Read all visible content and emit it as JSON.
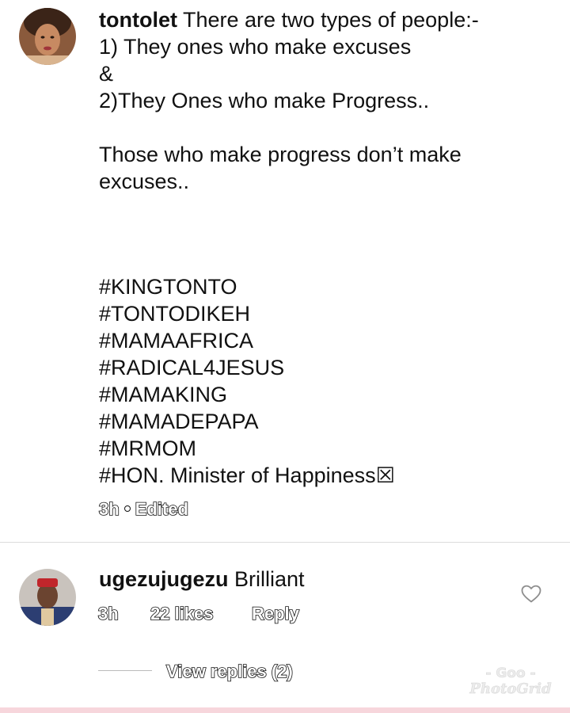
{
  "post": {
    "username": "tontolet",
    "caption_first_line": " There are two types of people:-",
    "caption_rest": "1) They ones who make excuses\n &\n2)They Ones who make Progress..\n\nThose who make progress don’t make excuses..",
    "hashtags": [
      "#KINGTONTO",
      "#TONTODIKEH",
      "#MAMAAFRICA",
      "#RADICAL4JESUS",
      "#MAMAKING",
      "#MAMADEPAPA",
      "#MRMOM",
      "#HON. Minister of Happiness☒"
    ],
    "time": "3h",
    "edited_label": "Edited"
  },
  "comment": {
    "username": "ugezujugezu",
    "text": " Brilliant",
    "time": "3h",
    "likes": "22 likes",
    "reply_label": "Reply",
    "view_replies": "View replies (2)"
  },
  "watermark": {
    "line1": "- Goo -",
    "line2": "PhotoGrid"
  },
  "icons": {
    "like": "heart-outline-icon"
  },
  "colors": {
    "text": "#111111",
    "divider": "#dcdcdc",
    "bottom_strip": "#f7d6dc"
  }
}
